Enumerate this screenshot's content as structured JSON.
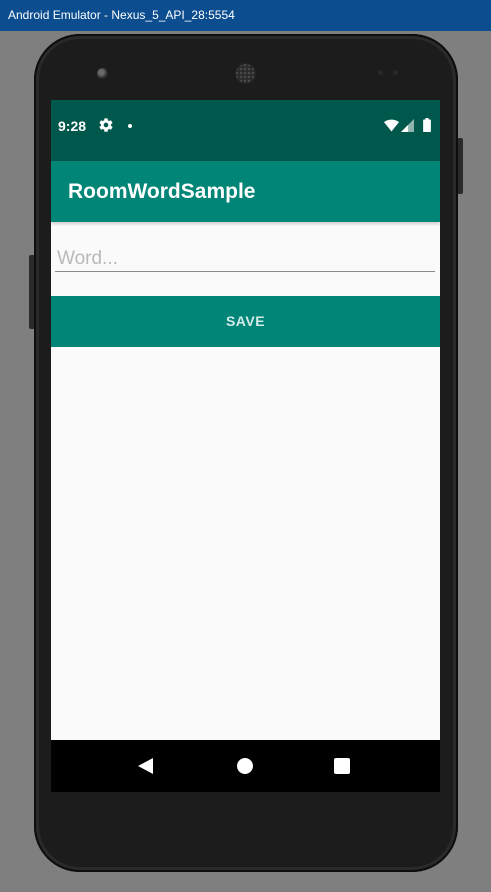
{
  "window": {
    "title": "Android Emulator - Nexus_5_API_28:5554"
  },
  "status_bar": {
    "time": "9:28",
    "icons": [
      "gear-icon",
      "notification-dot-icon",
      "wifi-icon",
      "cell-signal-icon",
      "battery-icon"
    ]
  },
  "app_bar": {
    "title": "RoomWordSample"
  },
  "word_input": {
    "value": "",
    "placeholder": "Word..."
  },
  "save_button": {
    "label": "SAVE"
  },
  "nav_bar": {
    "icons": [
      "back-icon",
      "home-icon",
      "recents-icon"
    ]
  },
  "colors": {
    "primary": "#008577",
    "primary_dark": "#00574b",
    "background": "#fafafa",
    "window_titlebar": "#0b4d8f"
  }
}
